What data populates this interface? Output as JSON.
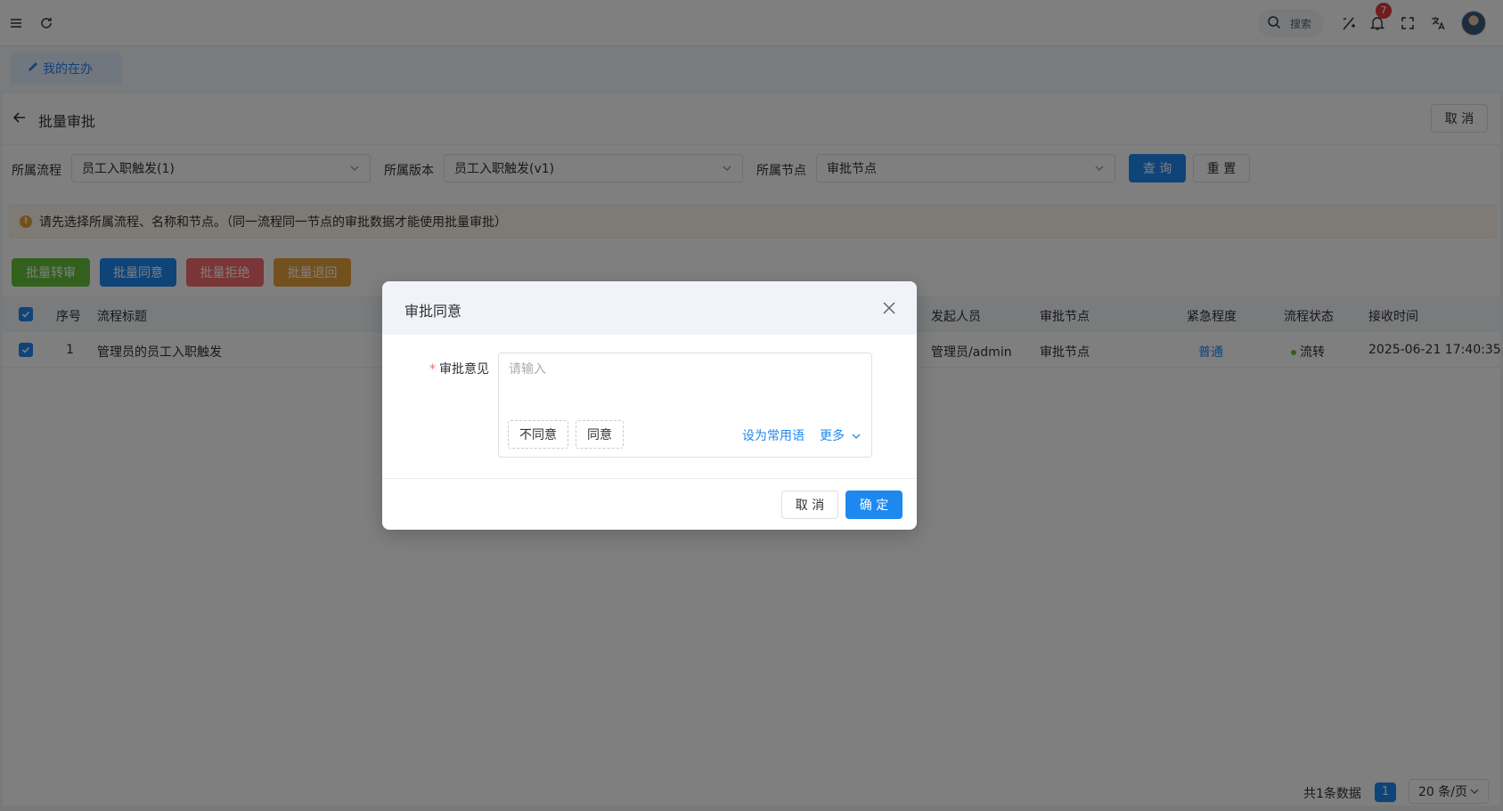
{
  "header": {
    "search_label": "搜索",
    "notification_count": "7",
    "icons": [
      "menu-icon",
      "refresh-icon",
      "search-icon",
      "ai-icon",
      "bell-icon",
      "fullscreen-icon",
      "translate-icon"
    ]
  },
  "tabs": [
    {
      "label": "我的在办",
      "active": true
    }
  ],
  "page": {
    "title": "批量审批",
    "cancel_label": "取 消"
  },
  "filters": {
    "process_label": "所属流程",
    "process_value": "员工入职触发(1)",
    "version_label": "所属版本",
    "version_value": "员工入职触发(v1)",
    "node_label": "所属节点",
    "node_value": "审批节点",
    "query_label": "查 询",
    "reset_label": "重 置"
  },
  "alert": {
    "text": "请先选择所属流程、名称和节点。（同一流程同一节点的审批数据才能使用批量审批）"
  },
  "actions": [
    {
      "label": "批量转审",
      "color": "#67c23a"
    },
    {
      "label": "批量同意",
      "color": "#1e88f0"
    },
    {
      "label": "批量拒绝",
      "color": "#f56c6c"
    },
    {
      "label": "批量退回",
      "color": "#e6a23c"
    }
  ],
  "table": {
    "columns": [
      "序号",
      "流程标题",
      "发起人员",
      "审批节点",
      "紧急程度",
      "流程状态",
      "接收时间"
    ],
    "rows": [
      {
        "index": "1",
        "title": "管理员的员工入职触发",
        "initiator": "管理员/admin",
        "node": "审批节点",
        "urgency": "普通",
        "status": "流转",
        "received": "2025-06-21 17:40:35"
      }
    ]
  },
  "pagination": {
    "total": "共1条数据",
    "current": "1",
    "page_size": "20 条/页"
  },
  "modal": {
    "title": "审批同意",
    "opinion_label": "审批意见",
    "opinion_placeholder": "请输入",
    "quick_disagree": "不同意",
    "quick_agree": "同意",
    "set_common": "设为常用语",
    "more": "更多",
    "cancel_label": "取 消",
    "ok_label": "确 定"
  },
  "colors": {
    "primary": "#1e88f0",
    "success": "#67c23a",
    "danger": "#f56c6c",
    "warning": "#e6a23c"
  }
}
